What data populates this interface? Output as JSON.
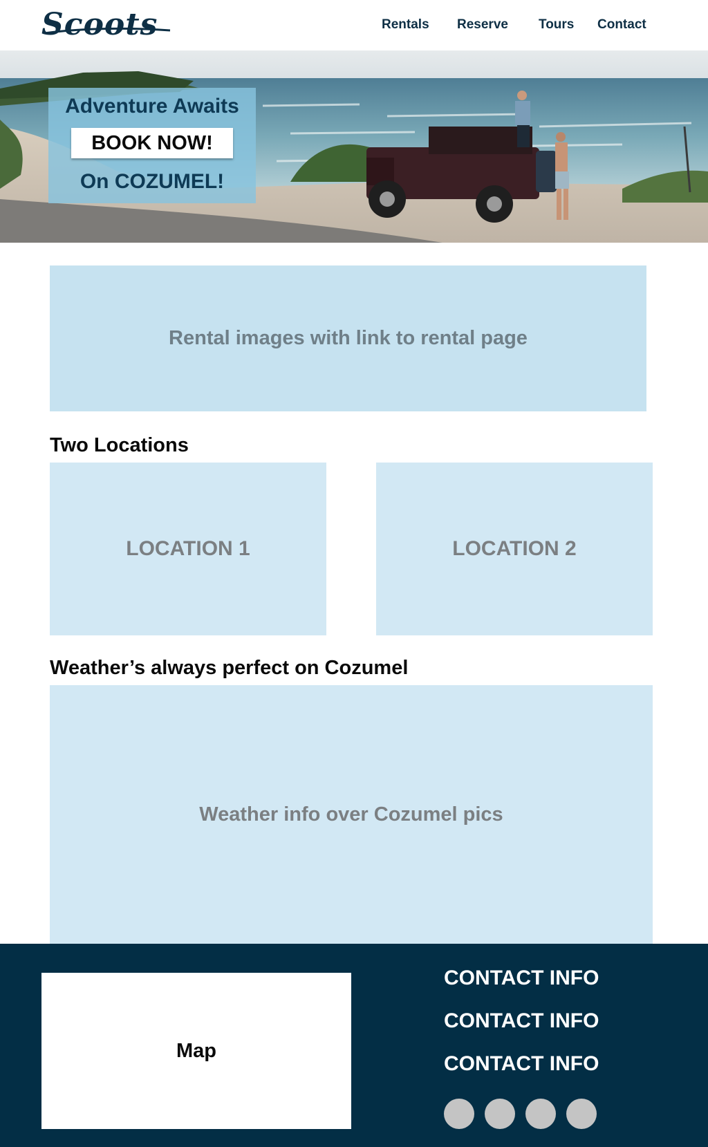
{
  "brand": {
    "logo_text": "Scoots"
  },
  "nav": {
    "items": [
      {
        "label": "Rentals"
      },
      {
        "label": "Reserve"
      },
      {
        "label": "Tours"
      },
      {
        "label": "Contact"
      }
    ]
  },
  "hero": {
    "headline": "Adventure Awaits",
    "cta_label": "BOOK NOW!",
    "subline": "On COZUMEL!"
  },
  "rentals": {
    "placeholder": "Rental images with link to rental page"
  },
  "locations": {
    "heading": "Two Locations",
    "items": [
      {
        "label": "LOCATION 1"
      },
      {
        "label": "LOCATION 2"
      }
    ]
  },
  "weather": {
    "heading": "Weather’s always perfect on Cozumel",
    "placeholder": "Weather info over Cozumel pics"
  },
  "footer": {
    "map_label": "Map",
    "contact_lines": [
      "CONTACT INFO",
      "CONTACT INFO",
      "CONTACT INFO"
    ],
    "social_icons": [
      "social-icon-1",
      "social-icon-2",
      "social-icon-3",
      "social-icon-4"
    ]
  },
  "colors": {
    "navy": "#032e45",
    "brand_text": "#0e2f45",
    "light_blue": "#d2e8f4",
    "rental_blue": "#c6e2f0",
    "hero_overlay": "#87c3de"
  }
}
